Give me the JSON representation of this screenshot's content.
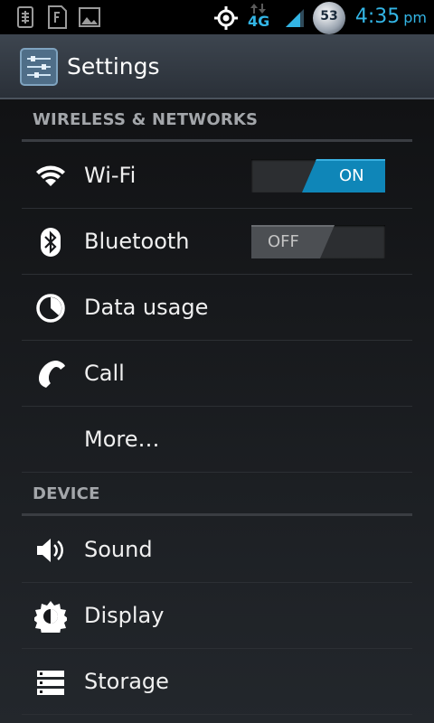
{
  "status_bar": {
    "time": "4:35",
    "ampm": "pm",
    "network_type": "4G",
    "notification_count": "53",
    "icons": [
      "usb-debug-icon",
      "sim-card-icon",
      "image-icon",
      "gps-icon",
      "signal-icon",
      "notification-count-icon"
    ]
  },
  "action_bar": {
    "title": "Settings",
    "icon": "settings-sliders-icon"
  },
  "sections": [
    {
      "header": "WIRELESS & NETWORKS",
      "items": [
        {
          "label": "Wi-Fi",
          "icon": "wifi-icon",
          "toggle": "ON"
        },
        {
          "label": "Bluetooth",
          "icon": "bluetooth-icon",
          "toggle": "OFF"
        },
        {
          "label": "Data usage",
          "icon": "data-usage-icon"
        },
        {
          "label": "Call",
          "icon": "phone-icon"
        },
        {
          "label": "More…"
        }
      ]
    },
    {
      "header": "DEVICE",
      "items": [
        {
          "label": "Sound",
          "icon": "sound-icon"
        },
        {
          "label": "Display",
          "icon": "display-icon"
        },
        {
          "label": "Storage",
          "icon": "storage-icon"
        }
      ]
    }
  ],
  "colors": {
    "accent": "#33b5e5",
    "toggle_on": "#0f86b8",
    "background": "#17181b",
    "section_header": "#a3a6aa"
  }
}
